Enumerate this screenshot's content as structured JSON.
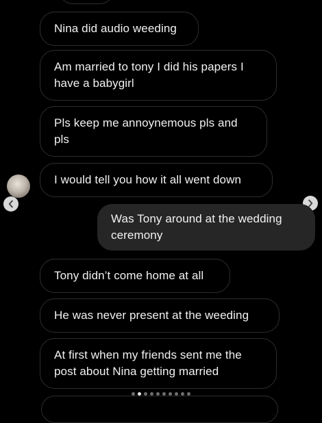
{
  "messages": [
    {
      "id": "m1",
      "side": "incoming",
      "text": "Nina did audio weeding"
    },
    {
      "id": "m2",
      "side": "incoming",
      "text": "Am married to tony I did his papers I have a babygirl"
    },
    {
      "id": "m3",
      "side": "incoming",
      "text": "Pls keep me annoynemous pls and pls"
    },
    {
      "id": "m4",
      "side": "incoming",
      "text": "I would tell you how it all went down"
    },
    {
      "id": "m5",
      "side": "outgoing",
      "text": "Was Tony around at the wedding ceremony"
    },
    {
      "id": "m6",
      "side": "incoming",
      "text": "Tony didn’t come home at all"
    },
    {
      "id": "m7",
      "side": "incoming",
      "text": "He was never present at the weeding"
    },
    {
      "id": "m8",
      "side": "incoming",
      "text": "At first when my friends sent me the post about Nina getting married"
    }
  ],
  "carousel": {
    "total_pages": 10,
    "current_page": 2,
    "prev_icon": "chevron-left-icon",
    "next_icon": "chevron-right-icon"
  },
  "colors": {
    "background": "#000000",
    "incoming_border": "#2e2e2e",
    "outgoing_fill": "#262626",
    "text": "#f2f2f2",
    "nav_button": "#d9d9d9"
  }
}
